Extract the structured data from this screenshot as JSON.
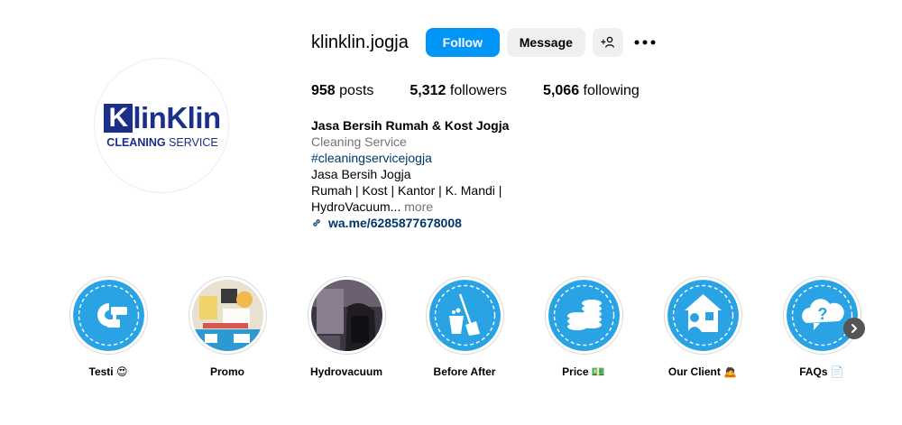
{
  "profile": {
    "username": "klinklin.jogja",
    "avatar_logo": {
      "brand_k": "K",
      "brand_word": "linKlin",
      "tagline_bold": "CLEANING",
      "tagline_rest": " SERVICE"
    }
  },
  "actions": {
    "follow_label": "Follow",
    "message_label": "Message",
    "add_user_label": "+⎇",
    "more_label": "•••"
  },
  "stats": {
    "posts_count": "958",
    "posts_label": "posts",
    "followers_count": "5,312",
    "followers_label": "followers",
    "following_count": "5,066",
    "following_label": "following"
  },
  "bio": {
    "name": "Jasa Bersih Rumah & Kost Jogja",
    "category": "Cleaning Service",
    "hashtag": "#cleaningservicejogja",
    "line1": "Jasa Bersih Jogja",
    "line2": "Rumah | Kost | Kantor | K. Mandi |",
    "line3": "HydroVacuum...",
    "more": "more",
    "link": "wa.me/6285877678008"
  },
  "highlights": [
    {
      "label": "Testi 😍",
      "icon": "testimonial-icon"
    },
    {
      "label": "Promo",
      "icon": "promo-photo"
    },
    {
      "label": "Hydrovacuum",
      "icon": "hydrovacuum-photo"
    },
    {
      "label": "Before After",
      "icon": "broom-bucket-icon"
    },
    {
      "label": "Price 💵",
      "icon": "coins-icon"
    },
    {
      "label": "Our Client 🙇",
      "icon": "client-house-icon"
    },
    {
      "label": "FAQs 📄",
      "icon": "question-cloud-icon"
    }
  ],
  "colors": {
    "follow_blue": "#0095f6",
    "highlight_blue": "#29a3e3",
    "link_blue": "#00376b",
    "logo_navy": "#1a2f8a"
  }
}
